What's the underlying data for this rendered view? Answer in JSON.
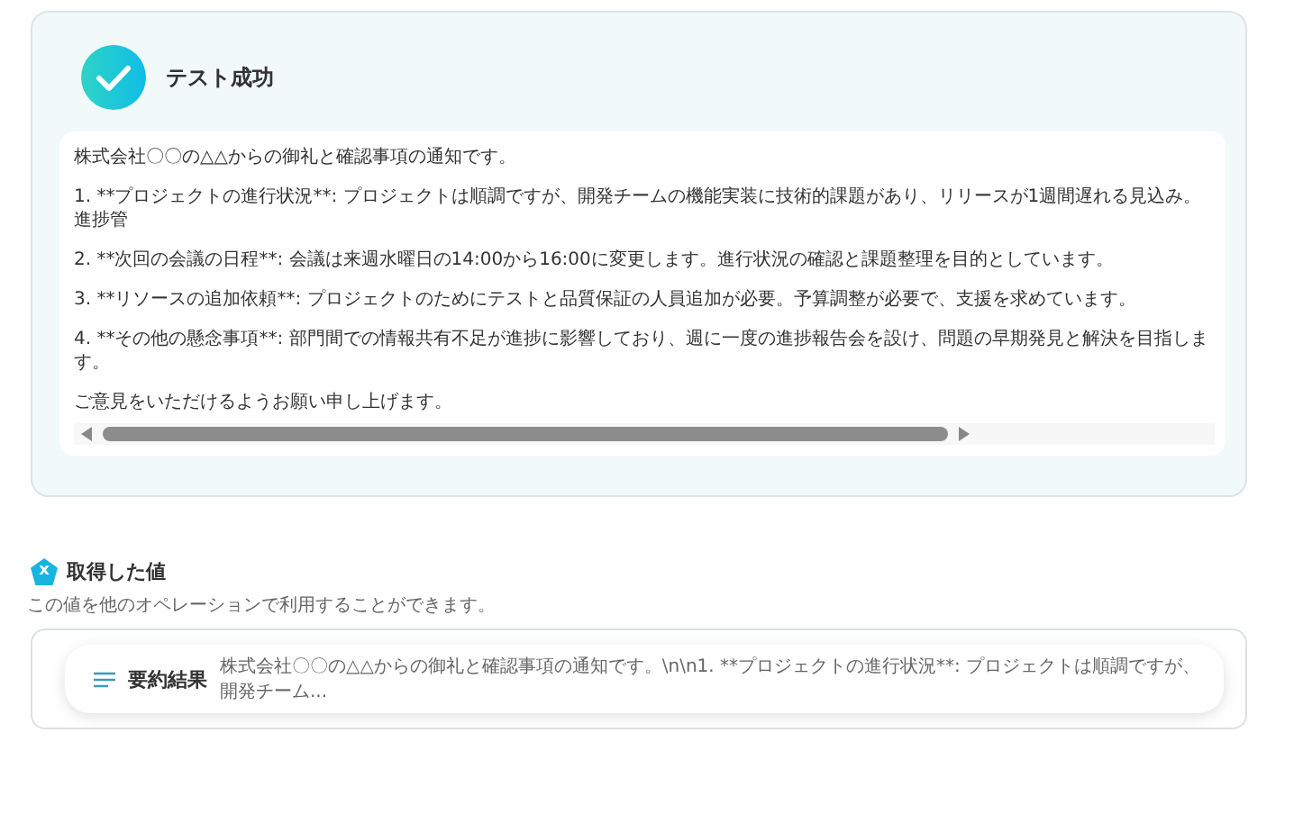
{
  "result_card": {
    "title": "テスト成功",
    "success": true,
    "output_lines": [
      "株式会社〇〇の△△からの御礼と確認事項の通知です。",
      "1. **プロジェクトの進行状況**: プロジェクトは順調ですが、開発チームの機能実装に技術的課題があり、リリースが1週間遅れる見込み。進捗管",
      "2. **次回の会議の日程**: 会議は来週水曜日の14:00から16:00に変更します。進行状況の確認と課題整理を目的としています。",
      "3. **リソースの追加依頼**: プロジェクトのためにテストと品質保証の人員追加が必要。予算調整が必要で、支援を求めています。",
      "4. **その他の懸念事項**: 部門間での情報共有不足が進捗に影響しており、週に一度の進捗報告会を設け、問題の早期発見と解決を目指します。",
      "ご意見をいただけるようお願い申し上げます。"
    ]
  },
  "values_section": {
    "badge": "x",
    "title": "取得した値",
    "description": "この値を他のオペレーションで利用することができます。",
    "items": [
      {
        "label": "要約結果",
        "value": "株式会社〇〇の△△からの御礼と確認事項の通知です。\\n\\n1. **プロジェクトの進行状況**: プロジェクトは順調ですが、開発チーム..."
      }
    ]
  }
}
